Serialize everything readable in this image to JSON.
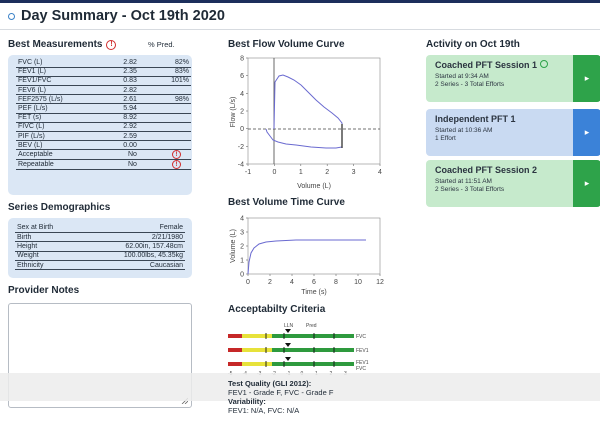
{
  "header": {
    "title": "Day Summary - Oct 19th 2020"
  },
  "best_measurements": {
    "title": "Best Measurements",
    "pct_label": "% Pred.",
    "rows": [
      {
        "name": "FVC (L)",
        "value": "2.82",
        "pred": "82%"
      },
      {
        "name": "FEV1 (L)",
        "value": "2.35",
        "pred": "83%"
      },
      {
        "name": "FEV1/FVC",
        "value": "0.83",
        "pred": "101%"
      },
      {
        "name": "FEV6 (L)",
        "value": "2.82",
        "pred": ""
      },
      {
        "name": "FEF2575 (L/s)",
        "value": "2.61",
        "pred": "98%"
      },
      {
        "name": "PEF (L/s)",
        "value": "5.94",
        "pred": ""
      },
      {
        "name": "FET (s)",
        "value": "8.92",
        "pred": ""
      },
      {
        "name": "FIVC (L)",
        "value": "2.92",
        "pred": ""
      },
      {
        "name": "PIF (L/s)",
        "value": "2.59",
        "pred": ""
      },
      {
        "name": "BEV (L)",
        "value": "0.00",
        "pred": ""
      },
      {
        "name": "Acceptable",
        "value": "No",
        "pred": ""
      },
      {
        "name": "Repeatable",
        "value": "No",
        "pred": ""
      }
    ],
    "warn_glyph": "!"
  },
  "series_demographics": {
    "title": "Series Demographics",
    "rows": [
      {
        "name": "Sex at Birth",
        "value": "Female"
      },
      {
        "name": "Birth",
        "value": "2/21/1980"
      },
      {
        "name": "Height",
        "value": "62.00in, 157.48cm"
      },
      {
        "name": "Weight",
        "value": "100.00lbs, 45.35kg"
      },
      {
        "name": "Ethnicity",
        "value": "Caucasian"
      }
    ]
  },
  "provider_notes": {
    "title": "Provider Notes",
    "value": ""
  },
  "flow_volume": {
    "title": "Best Flow Volume Curve",
    "ylabel": "Flow (L/s)",
    "xlabel": "Volume (L)",
    "xticks": [
      "-1",
      "0",
      "1",
      "2",
      "3",
      "4"
    ],
    "yticks": [
      "8",
      "6",
      "4",
      "2",
      "0",
      "-2",
      "-4"
    ]
  },
  "volume_time": {
    "title": "Best Volume Time Curve",
    "ylabel": "Volume (L)",
    "xlabel": "Time (s)",
    "xticks": [
      "0",
      "2",
      "4",
      "6",
      "8",
      "10",
      "12"
    ],
    "yticks": [
      "4",
      "3",
      "2",
      "1",
      "0"
    ]
  },
  "acceptability": {
    "title": "Acceptabilty Criteria",
    "lln_label": "LLN",
    "pred_label": "Pred",
    "rows": [
      "FVC",
      "FEV1",
      "FEV1\nFVC"
    ],
    "row_labels": [
      "FVC",
      "FEV1",
      "FEV1",
      "FVC"
    ],
    "scale": [
      "-5",
      "-4",
      "-3",
      "-2",
      "-1",
      "0",
      "1",
      "2",
      "3"
    ]
  },
  "test_quality": {
    "title": "Test Quality (GLI 2012):",
    "value": "FEV1 - Grade F, FVC - Grade F",
    "variability_title": "Variability:",
    "variability_value": "FEV1: N/A, FVC: N/A"
  },
  "activity": {
    "title": "Activity on Oct 19th",
    "cards": [
      {
        "name": "Coached PFT Session 1",
        "line1": "Started at 9:34 AM",
        "line2": "2 Series - 3 Total Efforts",
        "color": "green"
      },
      {
        "name": "Independent PFT 1",
        "line1": "Started at 10:36 AM",
        "line2": "1 Effort",
        "color": "blue"
      },
      {
        "name": "Coached PFT Session 2",
        "line1": "Started at 11:51 AM",
        "line2": "2 Series - 3 Total Efforts",
        "color": "green"
      }
    ]
  }
}
